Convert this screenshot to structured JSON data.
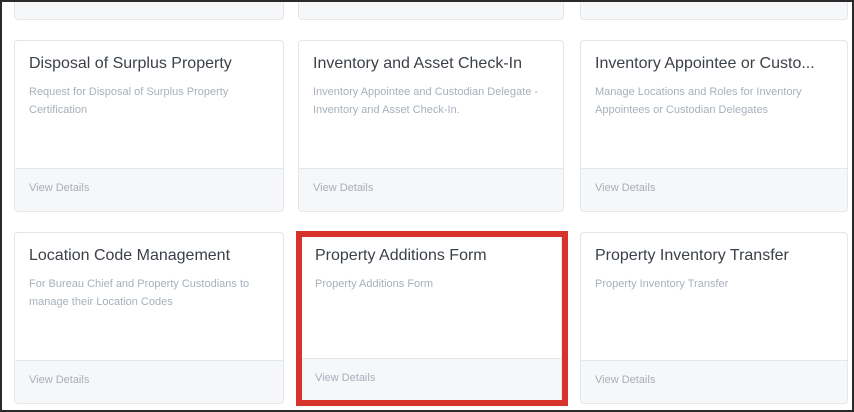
{
  "cards": [
    {
      "title": "Disposal of Surplus Property",
      "description": "Request for Disposal of Surplus Property Certification",
      "link": "View Details"
    },
    {
      "title": "Inventory and Asset Check-In",
      "description": "Inventory Appointee and Custodian Delegate - Inventory and Asset Check-In.",
      "link": "View Details"
    },
    {
      "title": "Inventory Appointee or Custo...",
      "description": "Manage Locations and Roles for Inventory Appointees or Custodian Delegates",
      "link": "View Details"
    },
    {
      "title": "Location Code Management",
      "description": "For Bureau Chief and Property Custodians to manage their Location Codes",
      "link": "View Details"
    },
    {
      "title": "Property Additions Form",
      "description": "Property Additions Form",
      "link": "View Details"
    },
    {
      "title": "Property Inventory Transfer",
      "description": "Property Inventory Transfer",
      "link": "View Details"
    }
  ],
  "highlight_color": "#d6332a"
}
